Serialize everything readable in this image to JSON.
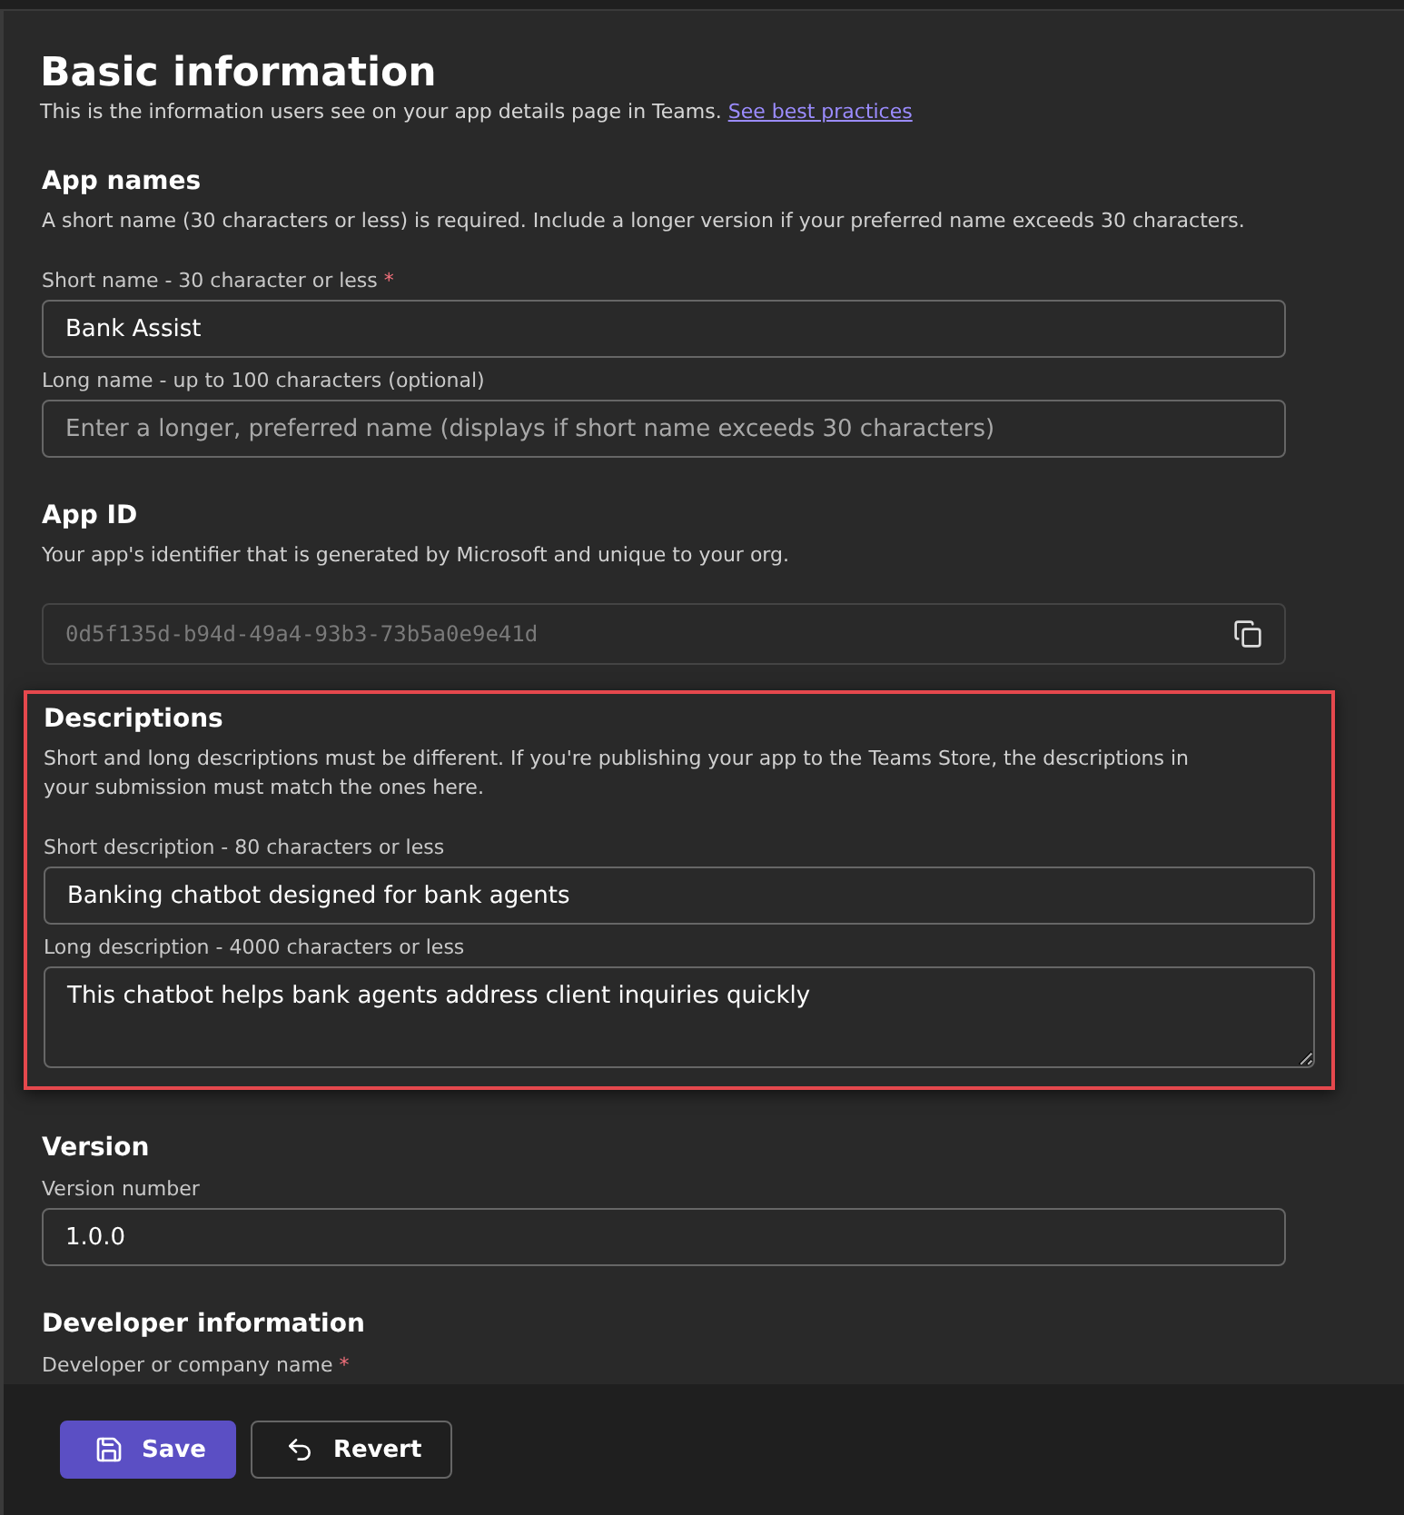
{
  "header": {
    "title": "Basic information",
    "subtitle": "This is the information users see on your app details page in Teams.",
    "link": "See best practices"
  },
  "sections": [
    {
      "title": "App names",
      "description": "A short name (30 characters or less) is required. Include a longer version if your preferred name exceeds 30 characters.",
      "highlighted": false,
      "fields": [
        {
          "kind": "text",
          "label": "Short name - 30 character or less",
          "required_mark": "*",
          "value": "Bank Assist"
        },
        {
          "kind": "text",
          "label": "Long name - up to 100 characters (optional)",
          "placeholder": "Enter a longer, preferred name (displays if short name exceeds 30 characters)"
        }
      ]
    },
    {
      "title": "App ID",
      "description": "Your app's identifier that is generated by Microsoft and unique to your org.",
      "highlighted": false,
      "fields": [
        {
          "kind": "readonly",
          "value": "0d5f135d-b94d-49a4-93b3-73b5a0e9e41d"
        }
      ]
    },
    {
      "title": "Descriptions",
      "description": "Short and long descriptions must be different. If you're publishing your app to the Teams Store, the descriptions in your submission must match the ones here.",
      "highlighted": true,
      "fields": [
        {
          "kind": "text",
          "label": "Short description - 80 characters or less",
          "value": "Banking chatbot designed for bank agents"
        },
        {
          "kind": "textarea",
          "label": "Long description - 4000 characters or less",
          "value": "This chatbot helps bank agents address client inquiries quickly"
        }
      ]
    },
    {
      "title": "Version",
      "highlighted": false,
      "fields": [
        {
          "kind": "text",
          "label": "Version number",
          "value": "1.0.0"
        }
      ]
    },
    {
      "title": "Developer information",
      "highlighted": false,
      "fields": [
        {
          "kind": "label",
          "label": "Developer or company name",
          "required_mark": "*"
        }
      ]
    }
  ],
  "footer": {
    "buttons": [
      {
        "kind": "primary",
        "label": "Save"
      },
      {
        "kind": "secondary",
        "label": "Revert"
      }
    ]
  }
}
